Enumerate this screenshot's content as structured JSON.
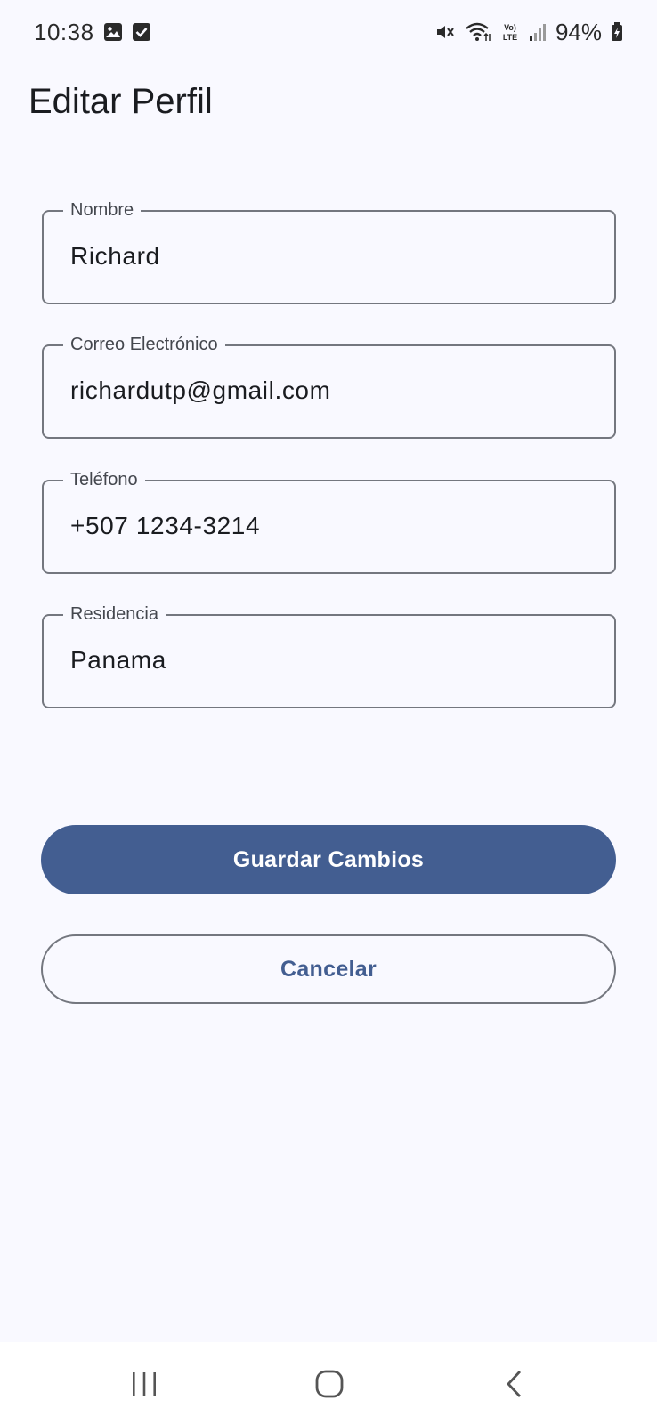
{
  "status_bar": {
    "time": "10:38",
    "battery_percent": "94%",
    "icons": [
      "gallery-icon",
      "checkbox-notification-icon",
      "mute-icon",
      "wifi-icon",
      "volte-icon",
      "signal-icon",
      "battery-charging-icon"
    ],
    "volte_text": "Vo) LTE"
  },
  "header": {
    "title": "Editar Perfil"
  },
  "form": {
    "fields": [
      {
        "label": "Nombre",
        "value": "Richard"
      },
      {
        "label": "Correo Electrónico",
        "value": "richardutp@gmail.com"
      },
      {
        "label": "Teléfono",
        "value": "+507 1234-3214"
      },
      {
        "label": "Residencia",
        "value": "Panama"
      }
    ]
  },
  "actions": {
    "save_label": "Guardar Cambios",
    "cancel_label": "Cancelar"
  },
  "colors": {
    "background": "#f9f9ff",
    "primary": "#435e91",
    "outline": "#74777f",
    "on_primary": "#ffffff"
  },
  "nav_bar": {
    "icons": [
      "recent-apps-icon",
      "home-icon",
      "back-icon"
    ]
  }
}
